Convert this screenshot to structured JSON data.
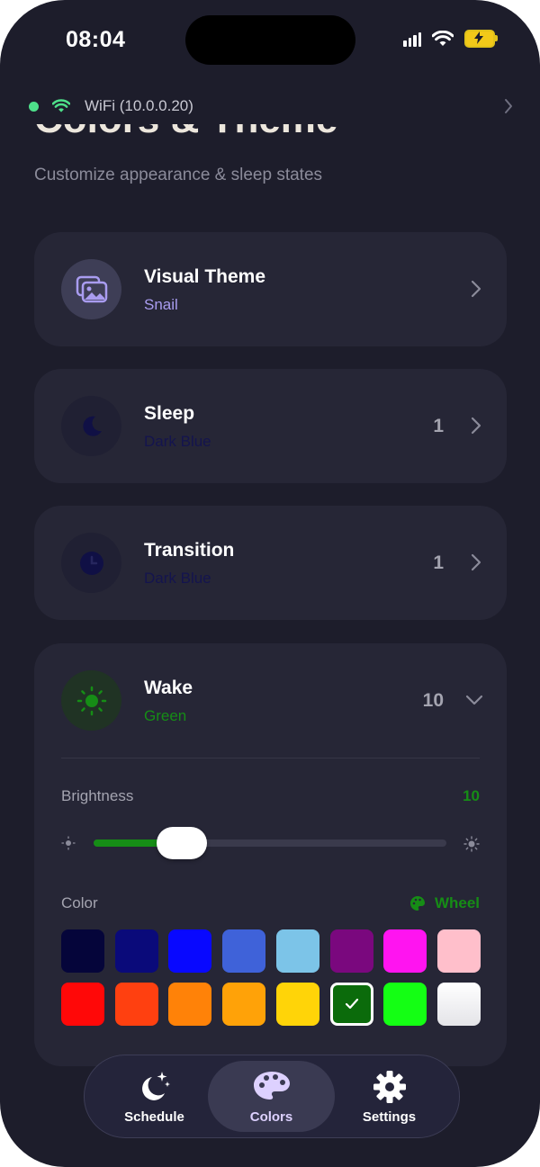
{
  "status_bar": {
    "time": "08:04"
  },
  "connection": {
    "label": "WiFi (10.0.0.20)",
    "status_color": "#4ee08a"
  },
  "page": {
    "title": "Colors & Theme",
    "subtitle": "Customize appearance & sleep states"
  },
  "cards": {
    "visual_theme": {
      "title": "Visual Theme",
      "value": "Snail",
      "icon": "photos-icon",
      "value_color": "#a99cf0"
    },
    "sleep": {
      "title": "Sleep",
      "value": "Dark Blue",
      "count": "1",
      "icon": "moon-icon",
      "value_color": "#14144e"
    },
    "transition": {
      "title": "Transition",
      "value": "Dark Blue",
      "count": "1",
      "icon": "clock-icon",
      "value_color": "#14144e"
    },
    "wake": {
      "title": "Wake",
      "value": "Green",
      "count": "10",
      "icon": "sun-icon",
      "value_color": "#168d16",
      "brightness_label": "Brightness",
      "brightness_value": "10",
      "brightness_fraction": 0.25,
      "color_label": "Color",
      "wheel_label": "Wheel",
      "swatches": [
        [
          "#05053a",
          "#0a0a7a",
          "#0808ff",
          "#3f62d9",
          "#7cc4e8",
          "#7a087e",
          "#ff14f0",
          "#ffbfcb"
        ],
        [
          "#ff0808",
          "#ff4010",
          "#ff8208",
          "#ffa208",
          "#ffd408",
          "#0b6b0b",
          "#14ff14",
          "#f4f4f4"
        ]
      ],
      "selected_swatch": "1-5"
    }
  },
  "tab_bar": {
    "tabs": [
      {
        "label": "Schedule",
        "icon": "moon-stars-icon"
      },
      {
        "label": "Colors",
        "icon": "palette-icon"
      },
      {
        "label": "Settings",
        "icon": "gear-icon"
      }
    ],
    "active": "Colors"
  }
}
